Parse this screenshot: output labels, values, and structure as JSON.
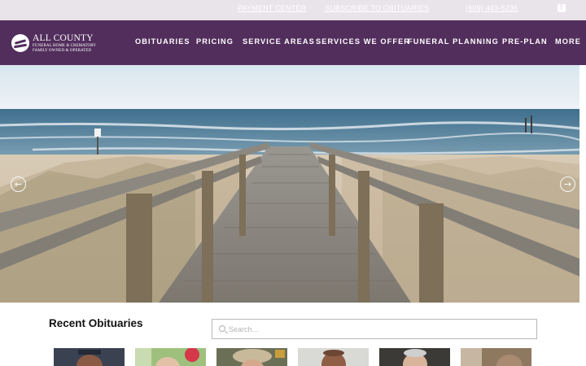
{
  "topbar": {
    "links": [
      "PAYMENT CENTER",
      "SUBSCRIBE TO OBITUARIES",
      "(609) 443-5236"
    ],
    "social_icon": "facebook-icon"
  },
  "brand": {
    "name": "ALL COUNTY",
    "line1": "FUNERAL HOME & CREMATORY",
    "line2": "FAMILY OWNED & OPERATED"
  },
  "nav": {
    "items": [
      "OBITUARIES",
      "PRICING",
      "SERVICE AREAS",
      "SERVICES WE OFFER",
      "FUNERAL PLANNING",
      "PRE-PLAN",
      "MORE"
    ]
  },
  "hero": {
    "prev_icon": "arrow-left-icon",
    "next_icon": "arrow-right-icon"
  },
  "obituaries": {
    "title": "Recent Obituaries",
    "search_placeholder": "Search...",
    "photo_count": 6
  },
  "colors": {
    "brand_purple": "#522e5c",
    "topbar_bg": "#e9e4ea"
  }
}
